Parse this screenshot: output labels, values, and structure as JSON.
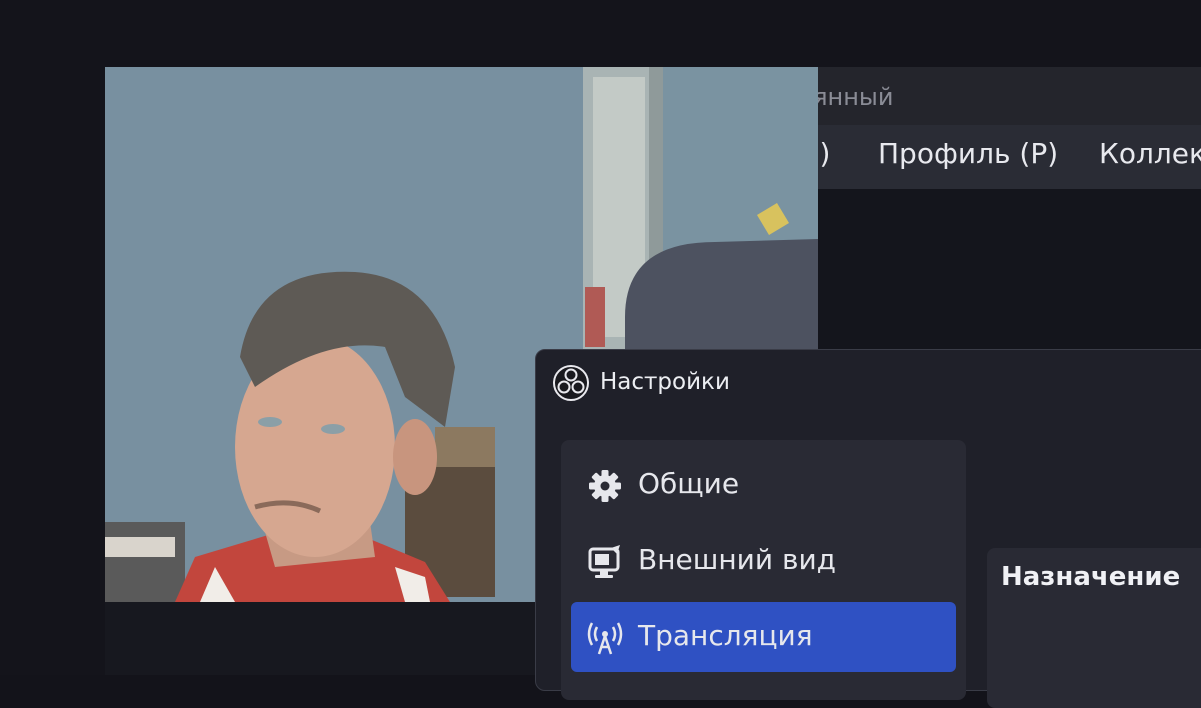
{
  "obs_main": {
    "title_fragment": "мянный",
    "menu": [
      {
        "label": "D)"
      },
      {
        "label": "Профиль (P)"
      },
      {
        "label": "Коллек"
      }
    ]
  },
  "settings": {
    "title": "Настройки",
    "sidebar": [
      {
        "label": "Общие",
        "icon": "gear-icon"
      },
      {
        "label": "Внешний вид",
        "icon": "appearance-icon"
      },
      {
        "label": "Трансляция",
        "icon": "broadcast-antenna-icon",
        "active": true
      }
    ],
    "content_heading": "Назначение"
  },
  "colors": {
    "accent": "#2f51c3",
    "window_bg": "#1f2029",
    "panel_bg": "#292a34"
  }
}
